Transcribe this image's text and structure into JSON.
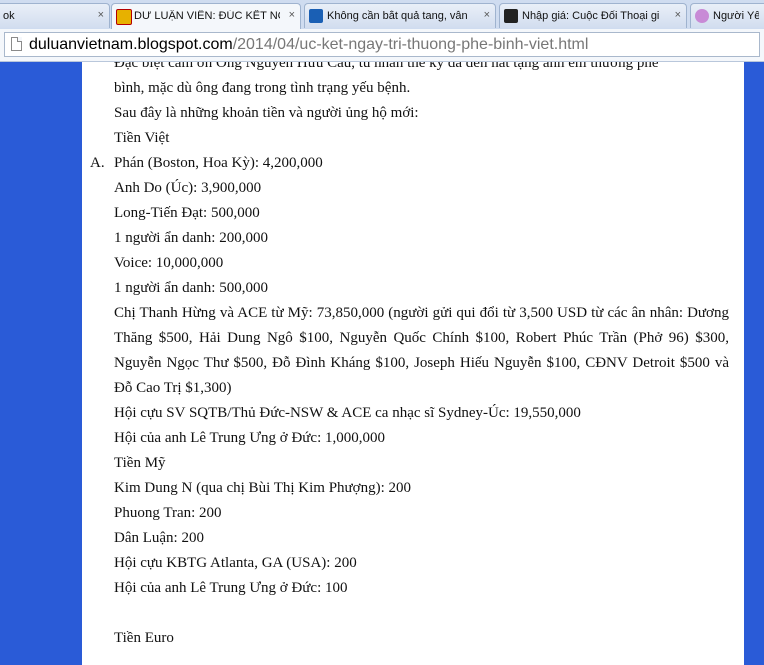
{
  "browser": {
    "tabs": [
      {
        "title": "ok",
        "active": false
      },
      {
        "title": "DƯ LUẬN VIÊN: ĐÚC KẾT NG",
        "active": true
      },
      {
        "title": "Không cần bắt quả tang, vẫn",
        "active": false
      },
      {
        "title": "Nhập giá: Cuộc Đối Thoại gi",
        "active": false
      },
      {
        "title": "Người Yêu",
        "active": false
      }
    ],
    "close_glyph": "×",
    "url_domain": "duluanvietnam.blogspot.com",
    "url_path": "/2014/04/uc-ket-ngay-tri-thuong-phe-binh-viet.html"
  },
  "article": {
    "thanks_1": "Đặc biệt cảm ơn Ông Nguyễn Hữu Cầu, tù nhân thế kỷ đã đến hát tặng anh em thương phê",
    "thanks_2": "bình, mặc dù ông đang trong tình trạng yếu bệnh.",
    "intro": "Sau đây là những khoản tiền và người ủng hộ mới:",
    "vnd_heading": "Tiền Việt",
    "list_marker": "A.",
    "vnd_items": [
      "Phán (Boston, Hoa Kỳ): 4,200,000",
      "Anh Do (Úc): 3,900,000",
      "Long-Tiến Đạt: 500,000",
      "1 người ẩn danh: 200,000",
      "Voice: 10,000,000",
      "1 người ẩn danh: 500,000"
    ],
    "big_donation": "Chị Thanh Hừng và ACE từ Mỹ: 73,850,000 (người gửi qui đổi từ 3,500 USD từ các ân nhân: Dương Thăng $500, Hải Dung Ngô $100, Nguyễn Quốc Chính $100, Robert Phúc Trần (Phở 96) $300, Nguyễn Ngọc Thư $500, Đỗ Đình Kháng $100, Joseph Hiếu Nguyễn $100, CĐNV Detroit $500 và Đỗ Cao Trị $1,300)",
    "vnd_items_2": [
      "Hội cựu SV SQTB/Thủ Đức-NSW & ACE ca nhạc sĩ Sydney-Úc: 19,550,000",
      "Hội của anh Lê Trung Ưng ở Đức: 1,000,000"
    ],
    "usd_heading": "Tiền Mỹ",
    "usd_items": [
      "Kim Dung N (qua chị Bùi Thị Kim Phượng): 200",
      "Phuong Tran: 200",
      "Dân Luận: 200",
      "Hội cựu KBTG Atlanta, GA (USA): 200",
      "Hội của anh Lê Trung Ưng ở Đức: 100"
    ],
    "euro_heading": "Tiền Euro"
  }
}
